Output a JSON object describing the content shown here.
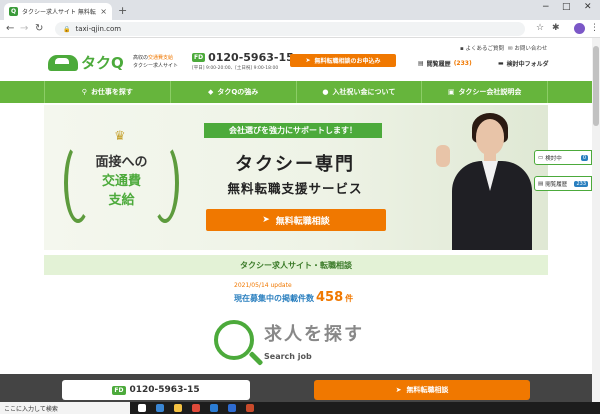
{
  "browser": {
    "tab_title": "タクシー求人サイト 無料転職相談[タ",
    "tab_close": "×",
    "new_tab": "+",
    "url": "taxi-qjin.com",
    "win_min": "−",
    "win_max": "□",
    "win_close": "✕"
  },
  "header": {
    "logo_text": "タクQ",
    "tagline_line1_pre": "高収の",
    "tagline_line1_hl": "交通費支給",
    "tagline_line2": "タクシー求人サイト",
    "phone_badge": "FD",
    "phone_number": "0120-5963-15",
    "phone_hours": "[平日] 9:00-20:00、[土日祝] 9:00-18:00",
    "cta_label": "無料転職相談のお申込み",
    "faq_label": "よくあるご質問",
    "contact_label": "お問い合わせ",
    "history_label": "閲覧履歴",
    "history_count": "(233)",
    "folder_label": "検討中フォルダ"
  },
  "nav": {
    "items": [
      {
        "label": "お仕事を探す"
      },
      {
        "label": "タクQの強み"
      },
      {
        "label": "入社祝い金について"
      },
      {
        "label": "タクシー会社説明会"
      }
    ]
  },
  "hero": {
    "wreath_line1": "面接への",
    "wreath_line2": "交通費",
    "wreath_line3": "支給",
    "ribbon": "会社選びを強力にサポートします！",
    "title": "タクシー専門",
    "subtitle": "無料転職支援サービス",
    "cta": "無料転職相談"
  },
  "floating": {
    "considering_label": "検討中",
    "considering_count": "0",
    "history_label": "閲覧履歴",
    "history_count": "233"
  },
  "section": {
    "band": "タクシー求人サイト・転職相談",
    "update": "2021/05/14 update",
    "count_prefix": "現在募集中の掲載件数",
    "count_value": "458",
    "count_unit": "件",
    "find_title": "求人を探す",
    "find_sub": "Search job"
  },
  "bottom_bar": {
    "phone_badge": "FD",
    "phone_number": "0120-5963-15",
    "cta": "無料転職相談"
  },
  "taskbar": {
    "search_placeholder": "ここに入力して検索"
  },
  "colors": {
    "brand_green": "#4caa3b",
    "nav_green": "#66b53c",
    "accent_orange": "#f07800"
  }
}
